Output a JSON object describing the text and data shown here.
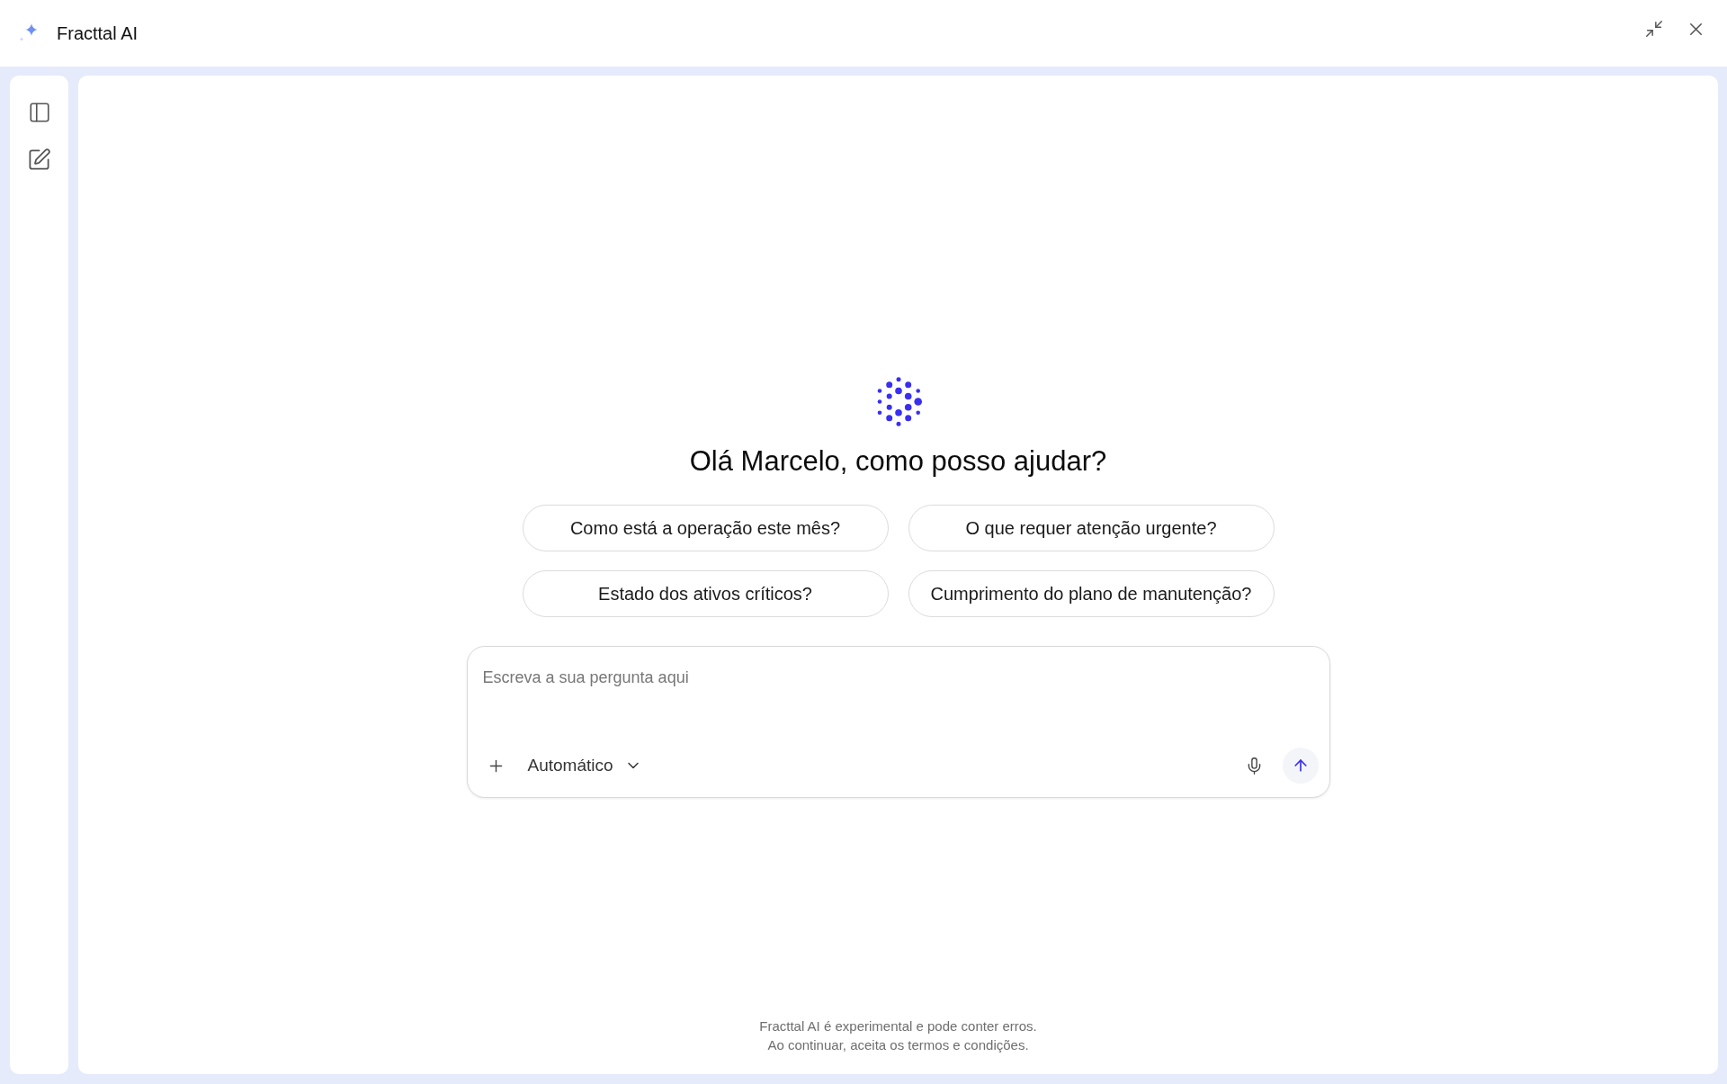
{
  "window": {
    "title": "Fracttal AI"
  },
  "greeting": "Olá Marcelo, como posso ajudar?",
  "suggestions": [
    "Como está a operação este mês?",
    "O que requer atenção urgente?",
    "Estado dos ativos críticos?",
    "Cumprimento do plano de manutenção?"
  ],
  "composer": {
    "placeholder": "Escreva a sua pergunta aqui",
    "mode": "Automático"
  },
  "disclaimer": [
    "Fracttal AI é experimental e pode conter erros.",
    "Ao continuar, aceita os termos e condições."
  ]
}
